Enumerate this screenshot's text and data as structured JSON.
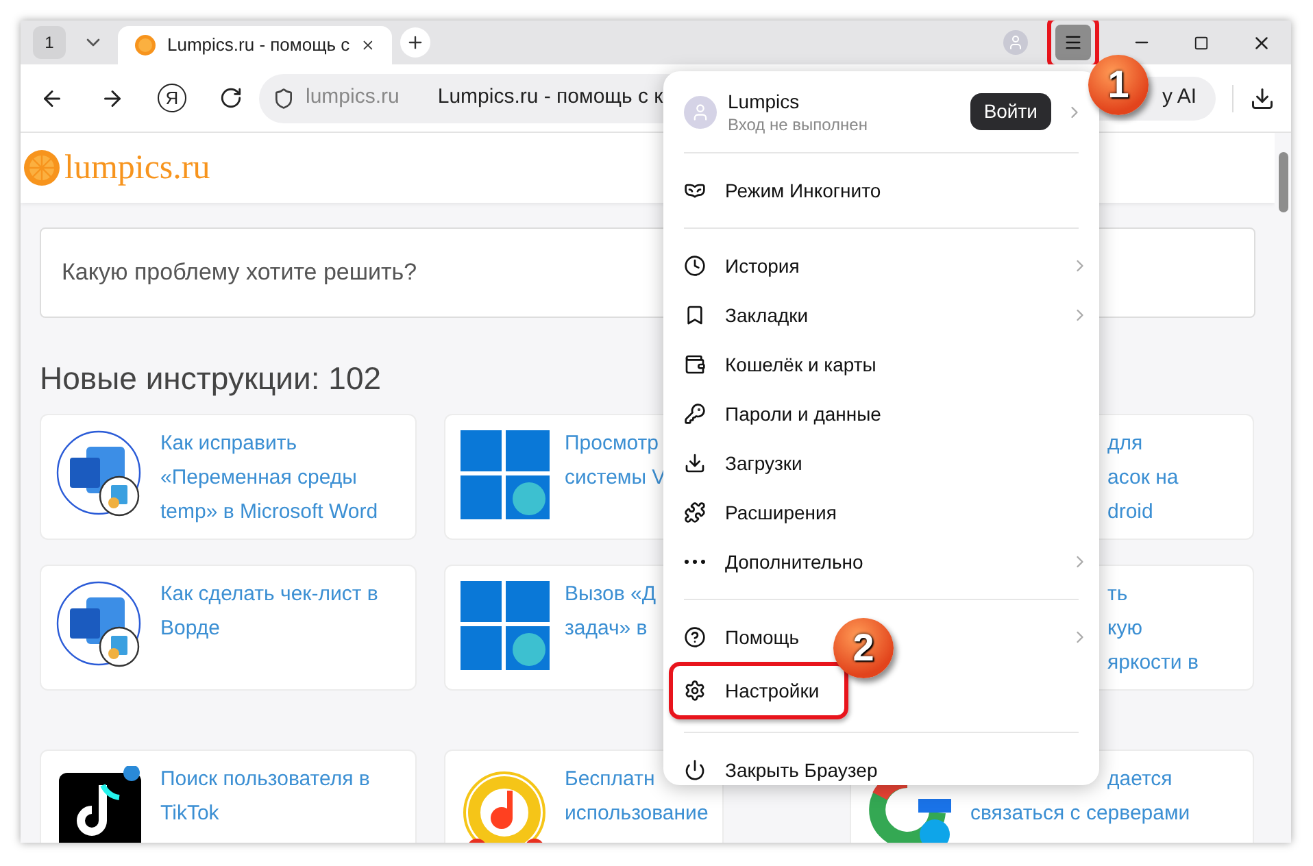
{
  "tabstrip": {
    "tab_count": "1",
    "tabs": [
      {
        "title": "Lumpics.ru - помощь с",
        "selected": true
      }
    ],
    "menu_button_annotated": true
  },
  "toolbar": {
    "home_logo": "Я",
    "address": {
      "domain": "lumpics.ru",
      "title": "Lumpics.ru - помощь с к"
    },
    "assistant": "y AI"
  },
  "site": {
    "logo": "lumpics.ru",
    "search": {
      "placeholder": "Какую проблему хотите решить?"
    },
    "heading": "Новые инструкции: 102",
    "cards": [
      {
        "kind": "document",
        "lines": [
          {
            "text": "Как исправить",
            "covered": false
          },
          {
            "text": "«Переменная среды",
            "covered": false
          },
          {
            "text": "temp» в Microsoft Word",
            "covered": false
          }
        ]
      },
      {
        "kind": "tiles",
        "lines": [
          {
            "text": "Просмотр",
            "covered": false
          },
          {
            "text": "системы V",
            "covered": false
          }
        ]
      },
      {
        "kind": "hidden",
        "lines": [
          {
            "text": "для",
            "covered": true
          },
          {
            "text": "асок на",
            "covered": true
          },
          {
            "text": "droid",
            "covered": true
          }
        ]
      },
      {
        "kind": "document",
        "lines": [
          {
            "text": "Как сделать чек-лист в",
            "covered": false
          },
          {
            "text": "Ворде",
            "covered": false
          }
        ]
      },
      {
        "kind": "tiles",
        "lines": [
          {
            "text": "Вызов «Д",
            "covered": false
          },
          {
            "text": "задач» в",
            "covered": false
          }
        ]
      },
      {
        "kind": "hidden",
        "lines": [
          {
            "text": "ть",
            "covered": true
          },
          {
            "text": "кую",
            "covered": true
          },
          {
            "text": "яркости в",
            "covered": true
          }
        ]
      },
      {
        "kind": "note",
        "lines": [
          {
            "text": "Поиск пользователя в",
            "covered": false
          },
          {
            "text": "TikTok",
            "covered": false
          }
        ]
      },
      {
        "kind": "music",
        "lines": [
          {
            "text": "Бесплатн",
            "covered": false
          },
          {
            "text": "использование",
            "covered": false
          }
        ]
      },
      {
        "kind": "ring",
        "lines": [
          {
            "text": "дается",
            "covered": true
          },
          {
            "text": "связаться с серверами",
            "covered": false
          }
        ]
      }
    ]
  },
  "menu": {
    "profile": {
      "name": "Lumpics",
      "status": "Вход не выполнен",
      "login": "Войти",
      "submenu": true
    },
    "sections": [
      [
        {
          "label": "Режим Инкогнито",
          "submenu": false,
          "highlighted": false
        }
      ],
      [
        {
          "label": "История",
          "submenu": true,
          "highlighted": false
        },
        {
          "label": "Закладки",
          "submenu": true,
          "highlighted": false
        },
        {
          "label": "Кошелёк и карты",
          "submenu": false,
          "highlighted": false
        },
        {
          "label": "Пароли и данные",
          "submenu": false,
          "highlighted": false
        },
        {
          "label": "Загрузки",
          "submenu": false,
          "highlighted": false
        },
        {
          "label": "Расширения",
          "submenu": false,
          "highlighted": false
        },
        {
          "label": "Дополнительно",
          "submenu": true,
          "highlighted": false
        }
      ],
      [
        {
          "label": "Помощь",
          "submenu": true,
          "highlighted": false
        },
        {
          "label": "Настройки",
          "submenu": false,
          "highlighted": true
        }
      ],
      [
        {
          "label": "Закрыть Браузер",
          "submenu": false,
          "highlighted": false
        }
      ]
    ]
  },
  "annotations": [
    "1",
    "2"
  ]
}
